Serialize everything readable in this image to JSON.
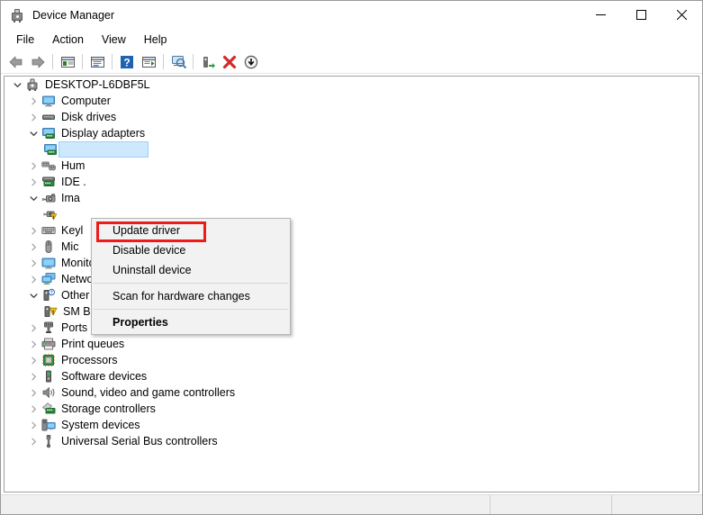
{
  "window": {
    "title": "Device Manager",
    "app_icon": "device-manager-icon",
    "caption": {
      "minimize": "minimize-icon",
      "maximize": "maximize-icon",
      "close": "close-icon"
    }
  },
  "menubar": {
    "items": [
      {
        "label": "File"
      },
      {
        "label": "Action"
      },
      {
        "label": "View"
      },
      {
        "label": "Help"
      }
    ]
  },
  "toolbar": {
    "buttons": [
      {
        "name": "back-icon"
      },
      {
        "name": "forward-icon"
      },
      {
        "name": "show-hide-console-tree-icon"
      },
      {
        "name": "properties-icon"
      },
      {
        "name": "help-icon"
      },
      {
        "name": "show-hide-action-pane-icon"
      },
      {
        "name": "scan-for-hardware-changes-icon"
      },
      {
        "name": "update-driver-icon"
      },
      {
        "name": "uninstall-device-icon"
      },
      {
        "name": "disable-device-icon"
      }
    ]
  },
  "tree": {
    "root": {
      "label": "DESKTOP-L6DBF5L",
      "icon": "computer-root-icon",
      "expanded": true
    },
    "nodes": [
      {
        "label": "Computer",
        "icon": "computer-icon",
        "indent": 1,
        "state": "collapsed",
        "selected": false
      },
      {
        "label": "Disk drives",
        "icon": "disk-drive-icon",
        "indent": 1,
        "state": "collapsed",
        "selected": false
      },
      {
        "label": "Display adapters",
        "icon": "display-adapter-icon",
        "indent": 1,
        "state": "expanded",
        "selected": false
      },
      {
        "label": "",
        "icon": "display-adapter-icon",
        "indent": 2,
        "state": "leaf",
        "selected": true
      },
      {
        "label": "Hum",
        "icon": "hid-icon",
        "indent": 1,
        "state": "collapsed",
        "selected": false
      },
      {
        "label": "IDE .",
        "icon": "ide-controller-icon",
        "indent": 1,
        "state": "collapsed",
        "selected": false
      },
      {
        "label": "Ima",
        "icon": "imaging-device-icon",
        "indent": 1,
        "state": "expanded",
        "selected": false
      },
      {
        "label": "",
        "icon": "imaging-device-warning-icon",
        "indent": 2,
        "state": "leaf",
        "selected": false
      },
      {
        "label": "Keyl",
        "icon": "keyboard-icon",
        "indent": 1,
        "state": "collapsed",
        "selected": false
      },
      {
        "label": "Mic",
        "icon": "mouse-icon",
        "indent": 1,
        "state": "collapsed",
        "selected": false
      },
      {
        "label": "Monitors",
        "icon": "monitor-icon",
        "indent": 1,
        "state": "collapsed",
        "selected": false
      },
      {
        "label": "Network adapters",
        "icon": "network-adapter-icon",
        "indent": 1,
        "state": "collapsed",
        "selected": false
      },
      {
        "label": "Other devices",
        "icon": "other-device-icon",
        "indent": 1,
        "state": "expanded",
        "selected": false
      },
      {
        "label": "SM Bus Controller",
        "icon": "unknown-device-warning-icon",
        "indent": 2,
        "state": "leaf",
        "selected": false
      },
      {
        "label": "Ports (COM & LPT)",
        "icon": "port-icon",
        "indent": 1,
        "state": "collapsed",
        "selected": false
      },
      {
        "label": "Print queues",
        "icon": "printer-icon",
        "indent": 1,
        "state": "collapsed",
        "selected": false
      },
      {
        "label": "Processors",
        "icon": "processor-icon",
        "indent": 1,
        "state": "collapsed",
        "selected": false
      },
      {
        "label": "Software devices",
        "icon": "software-device-icon",
        "indent": 1,
        "state": "collapsed",
        "selected": false
      },
      {
        "label": "Sound, video and game controllers",
        "icon": "sound-device-icon",
        "indent": 1,
        "state": "collapsed",
        "selected": false
      },
      {
        "label": "Storage controllers",
        "icon": "storage-controller-icon",
        "indent": 1,
        "state": "collapsed",
        "selected": false
      },
      {
        "label": "System devices",
        "icon": "system-device-icon",
        "indent": 1,
        "state": "collapsed",
        "selected": false
      },
      {
        "label": "Universal Serial Bus controllers",
        "icon": "usb-controller-icon",
        "indent": 1,
        "state": "collapsed",
        "selected": false
      }
    ]
  },
  "context_menu": {
    "items": [
      {
        "label": "Update driver",
        "bold": false,
        "highlighted": true
      },
      {
        "label": "Disable device",
        "bold": false,
        "highlighted": false
      },
      {
        "label": "Uninstall device",
        "bold": false,
        "highlighted": false
      },
      {
        "separator": true
      },
      {
        "label": "Scan for hardware changes",
        "bold": false,
        "highlighted": false
      },
      {
        "separator": true
      },
      {
        "label": "Properties",
        "bold": true,
        "highlighted": false
      }
    ],
    "highlight_color": "#ee1b1b"
  },
  "statusbar": {
    "pane1": "",
    "pane2": "",
    "pane3": ""
  },
  "colors": {
    "selection": "#cde8ff",
    "annotation_red": "#ee1b1b",
    "titlebar_bg": "#ffffff",
    "statusbar_bg": "#f0f0f0"
  }
}
